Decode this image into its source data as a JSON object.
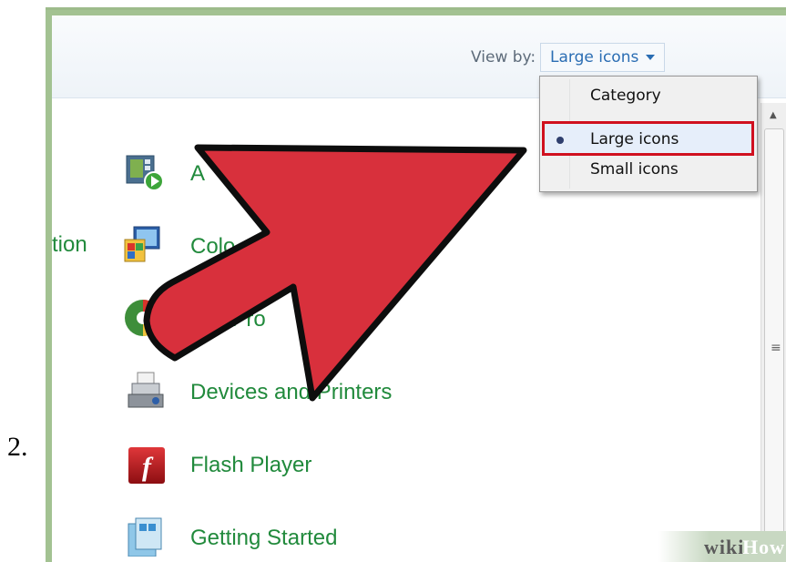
{
  "step_number": "2.",
  "toolbar": {
    "view_by_label": "View by:",
    "view_by_value": "Large icons"
  },
  "view_menu": {
    "items": [
      "Category",
      "Large icons",
      "Small icons"
    ],
    "selected": "Large icons"
  },
  "sidebar": {
    "partial_text": "tion"
  },
  "control_panel_items": [
    {
      "label": "A",
      "icon": "autoplay-icon"
    },
    {
      "label": "Colo",
      "icon": "color-management-icon"
    },
    {
      "label": "ault Pro",
      "icon": "default-programs-icon"
    },
    {
      "label": "Devices and Printers",
      "icon": "devices-printers-icon"
    },
    {
      "label": "Flash Player",
      "icon": "flash-player-icon"
    },
    {
      "label": "Getting Started",
      "icon": "getting-started-icon"
    }
  ],
  "watermark": {
    "wiki": "wiki",
    "how": "How"
  },
  "colors": {
    "arrow": "#d8303c",
    "link_green": "#218a3c",
    "highlight_border": "#d0101f"
  }
}
